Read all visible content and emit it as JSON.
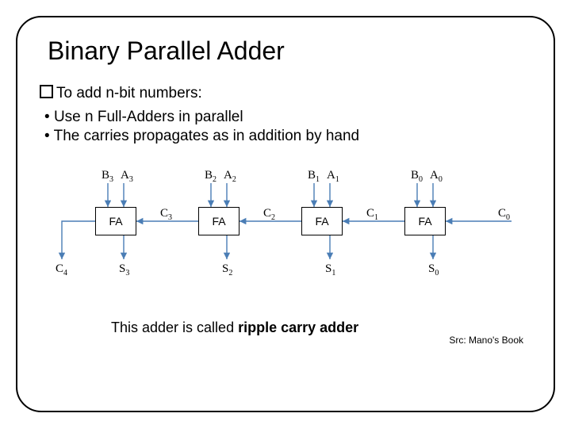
{
  "title": "Binary Parallel Adder",
  "lead": "To add n-bit numbers:",
  "bullets": [
    "Use n Full-Adders in parallel",
    "The carries propagates as in addition by hand"
  ],
  "diagram": {
    "fa_label": "FA",
    "top_labels": [
      {
        "b": "B",
        "bi": "3",
        "a": "A",
        "ai": "3"
      },
      {
        "b": "B",
        "bi": "2",
        "a": "A",
        "ai": "2"
      },
      {
        "b": "B",
        "bi": "1",
        "a": "A",
        "ai": "1"
      },
      {
        "b": "B",
        "bi": "0",
        "a": "A",
        "ai": "0"
      }
    ],
    "bottom_labels": [
      {
        "s": "S",
        "si": "3"
      },
      {
        "s": "S",
        "si": "2"
      },
      {
        "s": "S",
        "si": "1"
      },
      {
        "s": "S",
        "si": "0"
      }
    ],
    "carry_out": {
      "c": "C",
      "ci": "4"
    },
    "carries": [
      {
        "c": "C",
        "ci": "3"
      },
      {
        "c": "C",
        "ci": "2"
      },
      {
        "c": "C",
        "ci": "1"
      }
    ],
    "carry_in": {
      "c": "C",
      "ci": "0"
    }
  },
  "caption": "Src: Mano's Book",
  "tagline_prefix": "This adder is called ",
  "tagline_bold": "ripple carry adder"
}
